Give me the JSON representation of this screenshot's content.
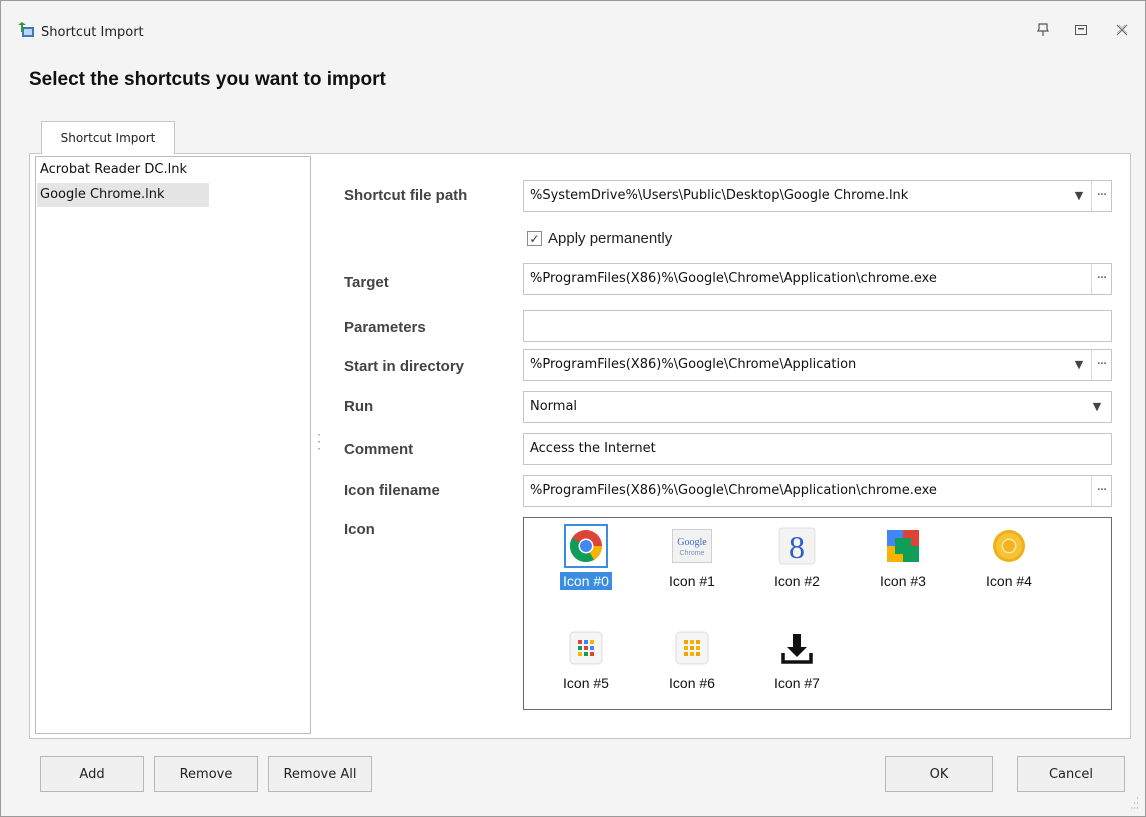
{
  "window": {
    "title": "Shortcut Import",
    "controls": [
      "pin-icon",
      "maximize-icon",
      "close-icon"
    ]
  },
  "heading": "Select the shortcuts you want to import",
  "tab": {
    "label": "Shortcut Import"
  },
  "shortcut_list": [
    {
      "label": "Acrobat Reader DC.lnk",
      "selected": false
    },
    {
      "label": "Google Chrome.lnk",
      "selected": true
    }
  ],
  "form": {
    "shortcut_path": {
      "label": "Shortcut file path",
      "value": "%SystemDrive%\\Users\\Public\\Desktop\\Google Chrome.lnk"
    },
    "apply_permanently": {
      "label": "Apply permanently",
      "checked": true
    },
    "target": {
      "label": "Target",
      "value": "%ProgramFiles(X86)%\\Google\\Chrome\\Application\\chrome.exe"
    },
    "parameters": {
      "label": "Parameters",
      "value": ""
    },
    "start_dir": {
      "label": "Start in directory",
      "value": "%ProgramFiles(X86)%\\Google\\Chrome\\Application"
    },
    "run": {
      "label": "Run",
      "value": "Normal"
    },
    "comment": {
      "label": "Comment",
      "value": "Access the Internet"
    },
    "icon_filename": {
      "label": "Icon filename",
      "value": "%ProgramFiles(X86)%\\Google\\Chrome\\Application\\chrome.exe"
    },
    "icon": {
      "label": "Icon"
    }
  },
  "icons": [
    {
      "label": "Icon #0",
      "name": "chrome-icon",
      "selected": true
    },
    {
      "label": "Icon #1",
      "name": "google-chrome-text-icon",
      "text1": "Google",
      "text2": "Chrome"
    },
    {
      "label": "Icon #2",
      "name": "google-g-icon",
      "glyph": "8"
    },
    {
      "label": "Icon #3",
      "name": "google-plus-colors-icon"
    },
    {
      "label": "Icon #4",
      "name": "chrome-canary-icon"
    },
    {
      "label": "Icon #5",
      "name": "apps-grid-color-icon"
    },
    {
      "label": "Icon #6",
      "name": "apps-grid-orange-icon"
    },
    {
      "label": "Icon #7",
      "name": "download-icon"
    }
  ],
  "buttons": {
    "add": "Add",
    "remove": "Remove",
    "remove_all": "Remove All",
    "ok": "OK",
    "cancel": "Cancel"
  },
  "colors": {
    "selection": "#3a8de0",
    "window_bg": "#f4f4f4",
    "chrome_red": "#db4437",
    "chrome_green": "#0f9d58",
    "chrome_yellow": "#f4b400",
    "chrome_blue": "#4285f4"
  }
}
